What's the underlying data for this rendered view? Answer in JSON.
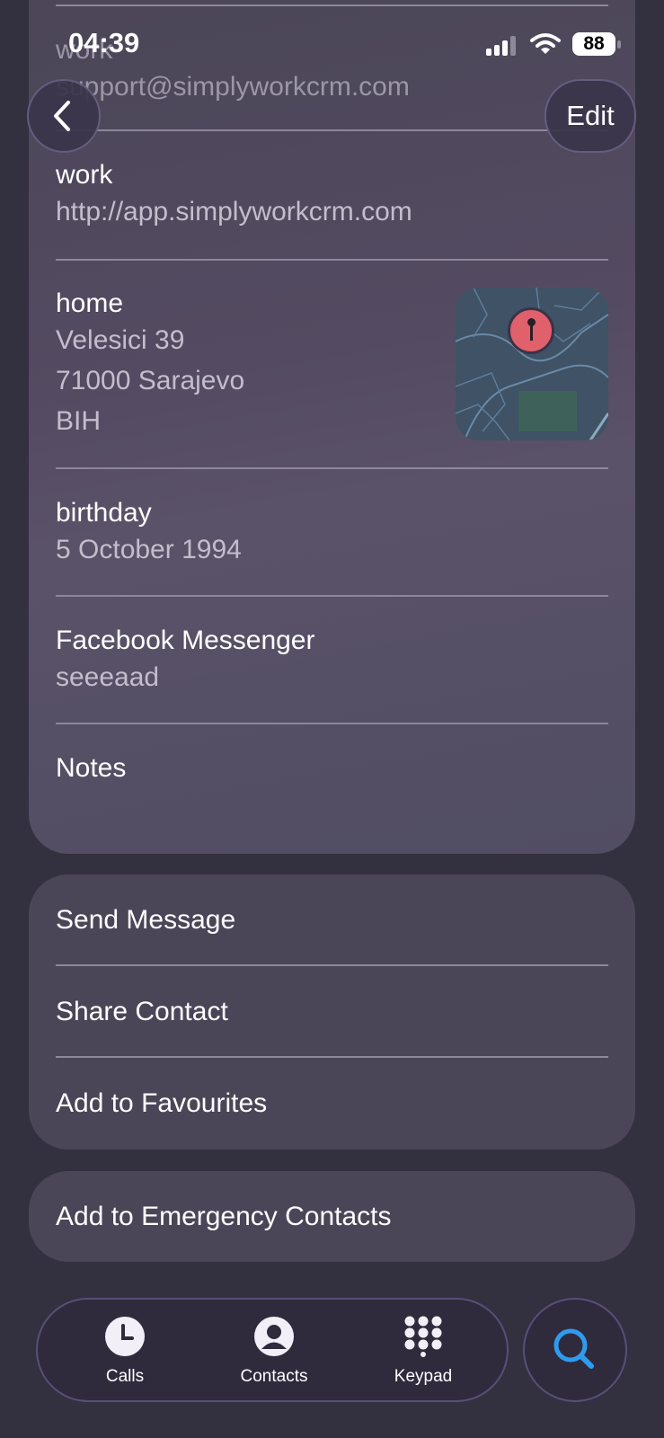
{
  "status_bar": {
    "time": "04:39",
    "battery": "88"
  },
  "nav": {
    "edit_label": "Edit"
  },
  "contact_fields": [
    {
      "label": "work",
      "value": "support@simplyworkcrm.com"
    },
    {
      "label": "work",
      "value": "http://app.simplyworkcrm.com"
    },
    {
      "label": "home",
      "lines": [
        "Velesici 39",
        "71000 Sarajevo",
        "BIH"
      ]
    },
    {
      "label": "birthday",
      "value": "5 October 1994"
    },
    {
      "label": "Facebook Messenger",
      "value": "seeeaad"
    },
    {
      "label": "Notes"
    }
  ],
  "actions": [
    "Send Message",
    "Share Contact",
    "Add to Favourites"
  ],
  "emergency": "Add to Emergency Contacts",
  "tab_bar": {
    "tabs": [
      {
        "label": "Calls",
        "icon": "clock-icon"
      },
      {
        "label": "Contacts",
        "icon": "person-icon"
      },
      {
        "label": "Keypad",
        "icon": "keypad-icon"
      }
    ],
    "search_icon": "search-icon"
  },
  "colors": {
    "accent": "#2f9bf0",
    "map_pin": "#e0606c"
  }
}
